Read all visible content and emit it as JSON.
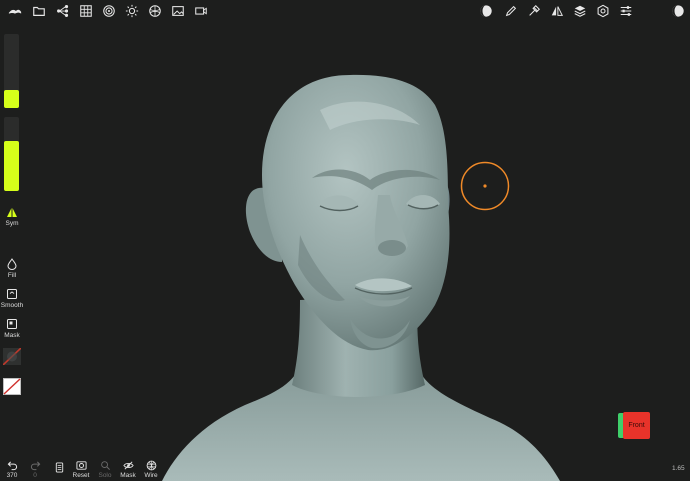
{
  "toolbar": {
    "left_icons": [
      "nomad-logo-icon",
      "folder-icon",
      "scene-graph-icon",
      "grid-icon",
      "target-icon",
      "sun-icon",
      "material-sphere-icon",
      "image-icon",
      "video-icon"
    ],
    "right_icons": [
      "shading-toggle-icon",
      "pencil-icon",
      "stroke-settings-icon",
      "symmetry-icon",
      "layers-icon",
      "settings-gear-icon",
      "sliders-icon",
      "shading-mode-icon"
    ]
  },
  "left_panel": {
    "radius_level": 0.25,
    "intensity_level": 0.68,
    "sym_label": "Sym",
    "fill_label": "Fill",
    "smooth_label": "Smooth",
    "mask_label": "Mask"
  },
  "bottom_bar": {
    "undo_label": "370",
    "redo_label": "0",
    "reset_label": "Reset",
    "solo_label": "Solo",
    "mask_label": "Mask",
    "wire_label": "Wire"
  },
  "view": {
    "cube_face_label": "Front",
    "version": "1.65"
  },
  "colors": {
    "background": "#1d1e1d",
    "slider_accent": "#d6ff1a",
    "brush_cursor": "#f08a28",
    "cube_front": "#e8332a",
    "cube_side": "#3fcf6a",
    "sculpt_material": "#8a9d9c"
  }
}
